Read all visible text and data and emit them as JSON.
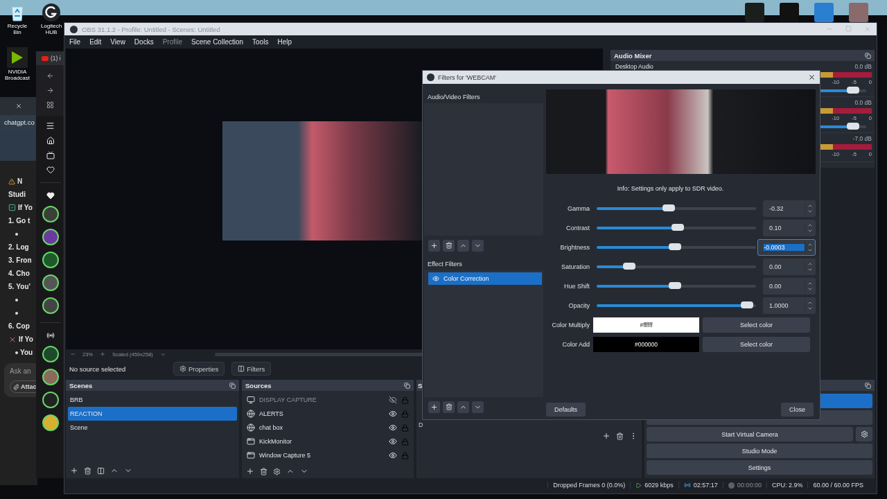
{
  "desktop": {
    "icons": [
      {
        "label": "Recycle Bin",
        "kind": "bin"
      },
      {
        "label": "Logitech HUB",
        "kind": "logitech"
      },
      {
        "label": "NVIDIA Broadcast",
        "kind": "nvidia"
      }
    ]
  },
  "chat_window": {
    "address": "chatgpt.co",
    "lines": [
      {
        "kind": "warning",
        "text": "N"
      },
      {
        "kind": "plain",
        "text": "Studi"
      },
      {
        "kind": "check",
        "text": "If Yo"
      },
      {
        "kind": "step",
        "number": "1.",
        "text": "Go t"
      },
      {
        "kind": "bullet"
      },
      {
        "kind": "step",
        "number": "2.",
        "text": "Log"
      },
      {
        "kind": "step",
        "number": "3.",
        "text": "Fron"
      },
      {
        "kind": "step",
        "number": "4.",
        "text": "Cho"
      },
      {
        "kind": "step",
        "number": "5.",
        "text": "You'"
      },
      {
        "kind": "bullet"
      },
      {
        "kind": "bullet"
      },
      {
        "kind": "step",
        "number": "6.",
        "text": "Cop"
      },
      {
        "kind": "cross",
        "text": "If Yo"
      },
      {
        "kind": "bullet",
        "text": "You"
      }
    ],
    "input_placeholder": "Ask an",
    "attach": "Attac"
  },
  "video_window": {
    "tab": "(1) i"
  },
  "obs": {
    "title": "OBS 31.1.2 - Profile: Untitled - Scenes: Untitled",
    "menu": [
      {
        "label": "File",
        "disabled": false
      },
      {
        "label": "Edit",
        "disabled": false
      },
      {
        "label": "View",
        "disabled": false
      },
      {
        "label": "Docks",
        "disabled": false
      },
      {
        "label": "Profile",
        "disabled": true
      },
      {
        "label": "Scene Collection",
        "disabled": false
      },
      {
        "label": "Tools",
        "disabled": false
      },
      {
        "label": "Help",
        "disabled": false
      }
    ],
    "preview": {
      "zoom": "23%",
      "scale": "Scaled (459x258)"
    },
    "source_bar": {
      "status": "No source selected",
      "properties": "Properties",
      "filters": "Filters"
    },
    "scenes": {
      "title": "Scenes",
      "items": [
        {
          "name": "BRB",
          "selected": false
        },
        {
          "name": "REACTION",
          "selected": true
        },
        {
          "name": "Scene",
          "selected": false
        }
      ]
    },
    "sources": {
      "title": "Sources",
      "items": [
        {
          "name": "DISPLAY CAPTURE",
          "kind": "display",
          "visible": false
        },
        {
          "name": "ALERTS",
          "kind": "browser",
          "visible": true
        },
        {
          "name": "chat box",
          "kind": "browser",
          "visible": true
        },
        {
          "name": "KickMonitor",
          "kind": "window",
          "visible": true
        },
        {
          "name": "Window Capture 5",
          "kind": "window",
          "visible": true
        }
      ]
    },
    "dock_3": {
      "title": "S",
      "label": "D"
    },
    "audio_mixer": {
      "title": "Audio Mixer",
      "channels": [
        {
          "name": "Desktop Audio",
          "reading": "0.0 dB",
          "scale": [
            "-10",
            "-5",
            "0"
          ],
          "level": 0.97
        },
        {
          "reading": "0.0 dB",
          "scale": [
            "-10",
            "-5",
            "0"
          ],
          "level": 0.97
        },
        {
          "reading": "-7.0 dB",
          "scale": [
            "-10",
            "-5",
            "0"
          ]
        }
      ]
    },
    "controls": {
      "buttons": [
        "Start Virtual Camera",
        "Studio Mode",
        "Settings"
      ]
    },
    "status_bar": {
      "dropped": "Dropped Frames 0 (0.0%)",
      "bitrate": "6029 kbps",
      "stream_time": "02:57:17",
      "record_time": "00:00:00",
      "cpu": "CPU: 2.9%",
      "fps": "60.00 / 60.00 FPS"
    }
  },
  "filters_dialog": {
    "title": "Filters for 'WEBCAM'",
    "av_title": "Audio/Video Filters",
    "effect_title": "Effect Filters",
    "effect_filters": [
      {
        "name": "Color Correction",
        "selected": true
      }
    ],
    "info": "Info: Settings only apply to SDR video.",
    "properties": [
      {
        "kind": "slider",
        "label": "Gamma",
        "level": 0.45,
        "value": "-0.32",
        "focused": false
      },
      {
        "kind": "slider",
        "label": "Contrast",
        "level": 0.51,
        "value": "0.10",
        "focused": false
      },
      {
        "kind": "slider",
        "label": "Brightness",
        "level": 0.49,
        "value": "-0.0003",
        "focused": true
      },
      {
        "kind": "slider",
        "label": "Saturation",
        "level": 0.18,
        "value": "0.00",
        "focused": false
      },
      {
        "kind": "slider",
        "label": "Hue Shift",
        "level": 0.49,
        "value": "0.00",
        "focused": false
      },
      {
        "kind": "slider",
        "label": "Opacity",
        "level": 0.98,
        "value": "1.0000",
        "focused": false
      },
      {
        "kind": "color",
        "label": "Color Multiply",
        "value": "#ffffff",
        "color": "#ffffff",
        "button": "Select color"
      },
      {
        "kind": "color",
        "label": "Color Add",
        "value": "#000000",
        "color": "#000000",
        "button": "Select color"
      }
    ],
    "defaults": "Defaults",
    "close": "Close"
  }
}
